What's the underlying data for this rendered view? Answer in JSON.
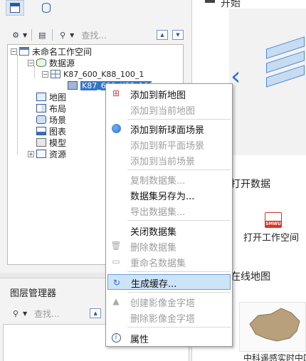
{
  "workspace_panel": {
    "tabs": [
      "workspace-tab",
      "datastore-tab"
    ],
    "toolbar": {
      "search_placeholder": "查找..."
    },
    "tree": {
      "workspace": "未命名工作空间",
      "datasources": "数据源",
      "datasource": "K87_600_K88_100_1",
      "selected_dataset": "K87_600_K88_100_1",
      "maps": "地图",
      "layouts": "布局",
      "scenes": "场景",
      "charts": "图表",
      "models": "模型",
      "resources": "资源"
    }
  },
  "layer_manager": {
    "title": "图层管理器",
    "search_placeholder": "查找..."
  },
  "start_page": {
    "top_label": "开始",
    "open_data": "打开数据",
    "open_workspace": "打开工作空间",
    "smwu_badge": "SMWU",
    "online_map": "在线地图",
    "thumb_caption": "中科遥感实时中国"
  },
  "context_menu": {
    "items": [
      {
        "label": "添加到新地图",
        "enabled": true,
        "icon": "add-to-map-icon"
      },
      {
        "label": "添加到当前地图",
        "enabled": false
      },
      {
        "label": "添加到新球面场景",
        "enabled": true,
        "icon": "add-to-globe-icon"
      },
      {
        "label": "添加到新平面场景",
        "enabled": false
      },
      {
        "label": "添加到当前场景",
        "enabled": false
      },
      {
        "label": "复制数据集...",
        "enabled": false
      },
      {
        "label": "数据集另存为...",
        "enabled": true
      },
      {
        "label": "导出数据集...",
        "enabled": false
      },
      {
        "label": "关闭数据集",
        "enabled": true
      },
      {
        "label": "删除数据集",
        "enabled": false,
        "icon": "trash-icon"
      },
      {
        "label": "重命名数据集",
        "enabled": false,
        "icon": "rename-icon"
      },
      {
        "label": "生成缓存...",
        "enabled": true,
        "highlighted": true,
        "icon": "cache-icon"
      },
      {
        "label": "创建影像金字塔",
        "enabled": false,
        "icon": "pyramid-icon"
      },
      {
        "label": "删除影像金字塔",
        "enabled": false
      },
      {
        "label": "属性",
        "enabled": true,
        "icon": "info-icon"
      }
    ]
  },
  "colors": {
    "selection": "#3574c7",
    "menu_highlight": "#cde3f8",
    "disabled_text": "#9e9e9e",
    "accent_blue": "#2f6fd0"
  }
}
